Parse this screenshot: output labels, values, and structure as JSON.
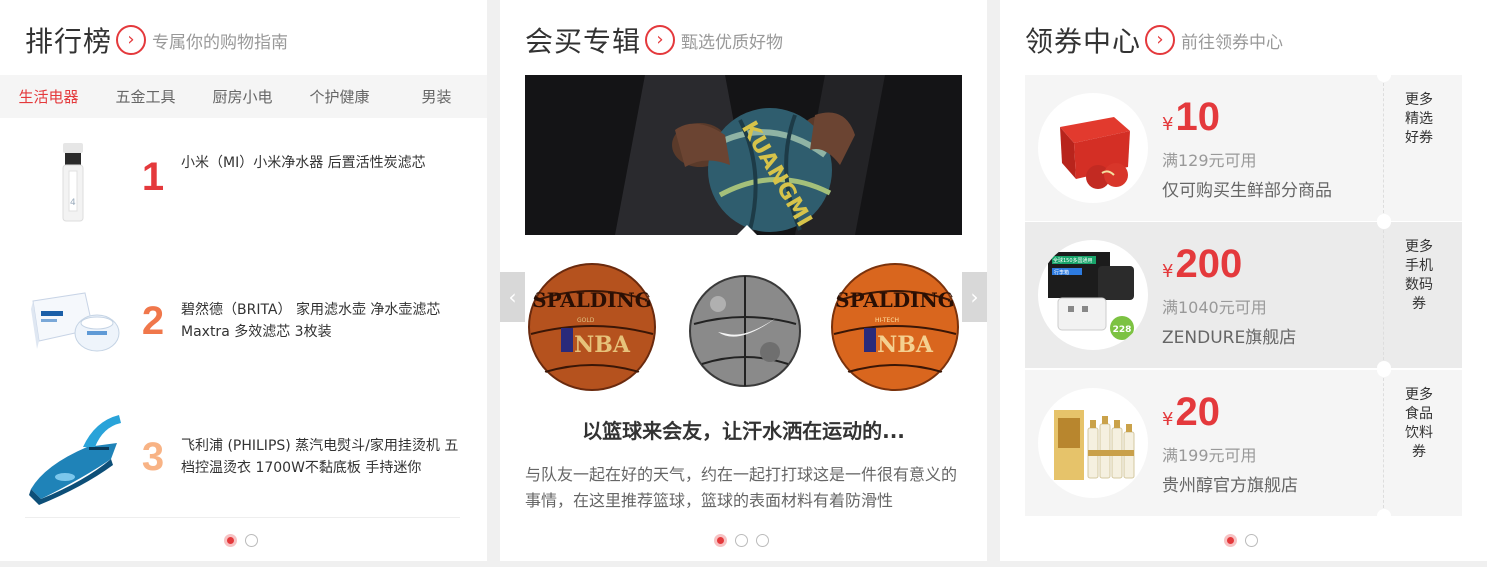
{
  "ranking": {
    "title": "排行榜",
    "subtitle": "专属你的购物指南",
    "tabs": [
      {
        "label": "生活电器",
        "active": true
      },
      {
        "label": "五金工具",
        "active": false
      },
      {
        "label": "厨房小电",
        "active": false
      },
      {
        "label": "个护健康",
        "active": false
      },
      {
        "label": "男装",
        "active": false
      }
    ],
    "items": [
      {
        "rank": "1",
        "name": "小米（MI）小米净水器 后置活性炭滤芯",
        "rank_color": "#e4393c"
      },
      {
        "rank": "2",
        "name": "碧然德（BRITA） 家用滤水壶 净水壶滤芯 Maxtra 多效滤芯 3枚装",
        "rank_color": "#f0774b"
      },
      {
        "rank": "3",
        "name": "飞利浦 (PHILIPS) 蒸汽电熨斗/家用挂烫机 五档控温烫衣 1700W不黏底板 手持迷你",
        "rank_color": "#f8b385"
      }
    ],
    "pagination": {
      "total": 2,
      "active": 0
    }
  },
  "album": {
    "title": "会买专辑",
    "subtitle": "甄选优质好物",
    "hero_brand": "KUANGMI",
    "balls": [
      {
        "brand": "SPALDING",
        "sub": "NBA",
        "type": "spalding-gold"
      },
      {
        "brand": "",
        "sub": "",
        "type": "nike-grey"
      },
      {
        "brand": "SPALDING",
        "sub": "NBA",
        "type": "spalding-hitech"
      }
    ],
    "ball_sub_text": [
      "GOLD",
      "HI-TECH"
    ],
    "headline": "以篮球来会友，让汗水洒在运动的...",
    "description": "与队友一起在好的天气，约在一起打打球这是一件很有意义的事情，在这里推荐篮球，篮球的表面材料有着防滑性",
    "arrows": {
      "prev": "‹",
      "next": "›"
    },
    "pagination": {
      "total": 3,
      "active": 0
    }
  },
  "coupons": {
    "title": "领券中心",
    "subtitle": "前往领券中心",
    "items": [
      {
        "currency": "¥",
        "amount": "10",
        "condition": "满129元可用",
        "scope": "仅可购买生鲜部分商品",
        "more": "更多精选好券",
        "image": "apple-box-icon"
      },
      {
        "currency": "¥",
        "amount": "200",
        "condition": "满1040元可用",
        "scope": "ZENDURE旗舰店",
        "more": "更多手机数码券",
        "image": "power-adapter-icon",
        "image_text": [
          "全球150多国通用",
          "行李箱",
          "228"
        ]
      },
      {
        "currency": "¥",
        "amount": "20",
        "condition": "满199元可用",
        "scope": "贵州醇官方旗舰店",
        "more": "更多食品饮料券",
        "image": "liquor-set-icon"
      }
    ],
    "pagination": {
      "total": 2,
      "active": 0
    }
  },
  "colors": {
    "accent": "#e4393c",
    "panel_bg": "#ffffff",
    "page_bg": "#f0f0f0"
  }
}
